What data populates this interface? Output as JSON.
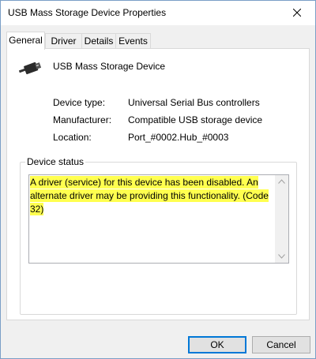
{
  "window": {
    "title": "USB Mass Storage Device Properties"
  },
  "tabs": [
    {
      "label": "General",
      "active": true
    },
    {
      "label": "Driver",
      "active": false
    },
    {
      "label": "Details",
      "active": false
    },
    {
      "label": "Events",
      "active": false
    }
  ],
  "device": {
    "name": "USB Mass Storage Device",
    "icon": "usb-plug-icon"
  },
  "properties": [
    {
      "label": "Device type:",
      "value": "Universal Serial Bus controllers"
    },
    {
      "label": "Manufacturer:",
      "value": "Compatible USB storage device"
    },
    {
      "label": "Location:",
      "value": "Port_#0002.Hub_#0003"
    }
  ],
  "device_status": {
    "legend": "Device status",
    "text": "A driver (service) for this device has been disabled.  An alternate driver may be providing this functionality. (Code 32)",
    "highlight_color": "#ffff4f"
  },
  "buttons": {
    "ok": "OK",
    "cancel": "Cancel"
  },
  "colors": {
    "accent": "#0078d7"
  }
}
